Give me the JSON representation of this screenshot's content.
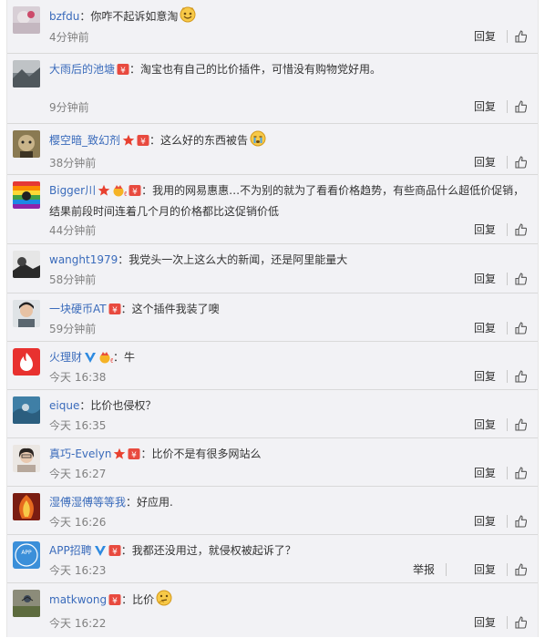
{
  "labels": {
    "reply": "回复",
    "report": "举报"
  },
  "colors": {
    "username": "#3a6bbb",
    "timestamp": "#808080",
    "vip_red": "#e84a3f",
    "verified_blue": "#2d8ae0"
  },
  "comments": [
    {
      "user": "bzfdu",
      "text": "：你咋不起诉如意淘",
      "time": "4分钟前",
      "badges": [
        "smiley-emoji-icon"
      ]
    },
    {
      "user": "大雨后的池塘",
      "text": "：淘宝也有自己的比价插件，可惜没有购物党好用。",
      "time": "9分钟前",
      "badges": [
        "vip-icon"
      ]
    },
    {
      "user": "樱空暗_致幻剂",
      "text": "：这么好的东西被告",
      "time": "38分钟前",
      "badges": [
        "star-icon",
        "vip-icon",
        "crying-emoji-icon"
      ]
    },
    {
      "user": "Bigger川",
      "text": "：我用的网易惠惠…不为别的就为了看看价格趋势，有些商品什么超低价促销，",
      "text2": "结果前段时间连着几个月的价格都比这促销价低",
      "time": "44分钟前",
      "badges": [
        "star-icon",
        "level-icon",
        "vip-icon"
      ]
    },
    {
      "user": "wanght1979",
      "text": "：我党头一次上这么大的新闻，还是阿里能量大",
      "time": "58分钟前",
      "badges": []
    },
    {
      "user": "一块硬币AT",
      "text": "：这个插件我装了噢",
      "time": "59分钟前",
      "badges": [
        "vip-icon"
      ]
    },
    {
      "user": "火理财",
      "text": "：牛",
      "time": "今天 16:38",
      "badges": [
        "verified-v-icon",
        "level-icon"
      ]
    },
    {
      "user": "eique",
      "text": "：比价也侵权？",
      "time": "今天 16:35",
      "badges": []
    },
    {
      "user": "真巧-Evelyn",
      "text": "：比价不是有很多网站么",
      "time": "今天 16:27",
      "badges": [
        "star-icon",
        "vip-icon"
      ]
    },
    {
      "user": "湿傅湿傅等等我",
      "text": "：好应用.",
      "time": "今天 16:26",
      "badges": []
    },
    {
      "user": "APP招聘",
      "text": "：我都还没用过，就侵权被起诉了？",
      "time": "今天 16:23",
      "badges": [
        "verified-v-icon",
        "vip-icon"
      ],
      "report": true
    },
    {
      "user": "matkwong",
      "text": "：比价",
      "time": "今天 16:22",
      "badges": [
        "vip-icon",
        "thinking-emoji-icon"
      ]
    }
  ]
}
